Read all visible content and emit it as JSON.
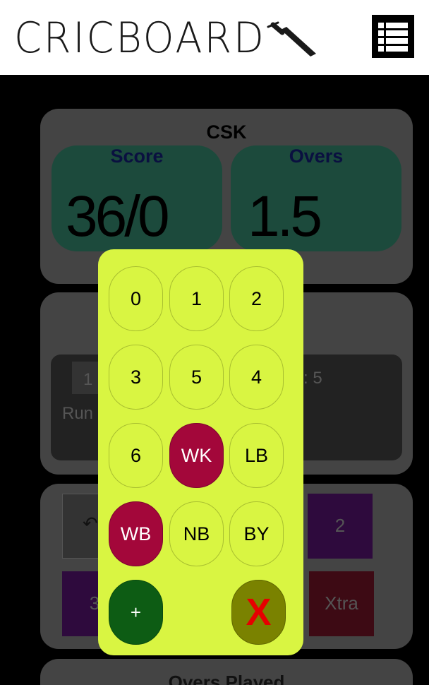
{
  "header": {
    "logo_text": "CRICBOARD",
    "bat_icon": "cricket-bat-icon",
    "menu_icon": "list-menu-icon"
  },
  "scoreboard": {
    "team": "CSK",
    "score_label": "Score",
    "score_value": "36/0",
    "overs_label": "Overs",
    "overs_value": "1.5"
  },
  "current": {
    "chip_value": "1",
    "runs_label": "Run",
    "right_value": ": 5"
  },
  "background_buttons": {
    "undo_icon": "undo-icon",
    "two_label": "2",
    "three_label": "3",
    "xtra_label": "Xtra"
  },
  "overs_played_title": "Overs Played",
  "keypad": {
    "keys": [
      "0",
      "1",
      "2",
      "3",
      "5",
      "4",
      "6",
      "WK",
      "LB",
      "WB",
      "NB",
      "BY"
    ],
    "add_label": "+",
    "close_label": "X"
  },
  "colors": {
    "popup_bg": "#d9f542",
    "wicket_red": "#a3073a",
    "add_green": "#0d5c14",
    "close_olive": "#7a8200",
    "close_x": "#e60000"
  }
}
